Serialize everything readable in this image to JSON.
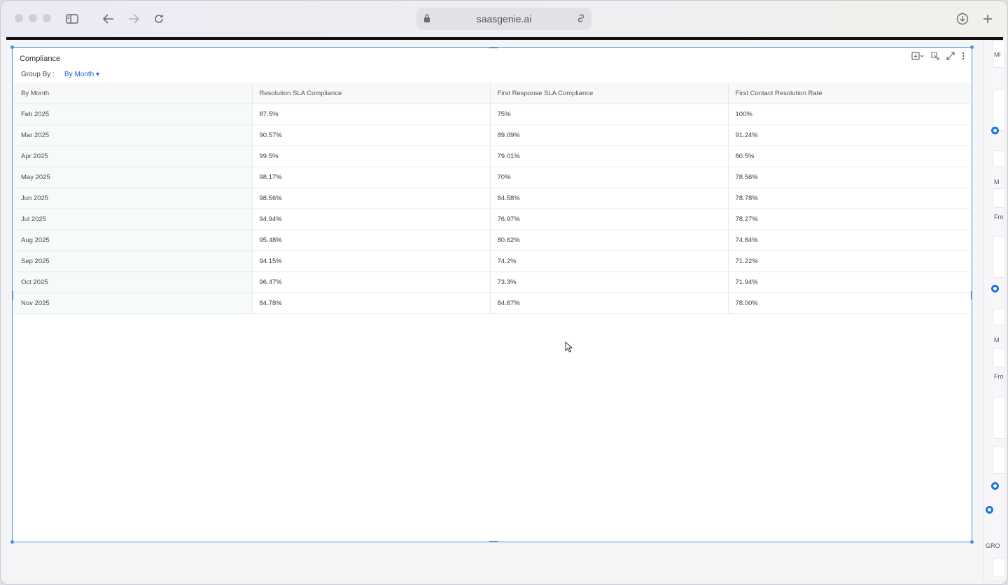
{
  "browser": {
    "url": "saasgenie.ai"
  },
  "widget": {
    "title": "Compliance",
    "group_by_label": "Group By :",
    "group_by_value": "By Month",
    "columns": [
      "By Month",
      "Resolution SLA Compliance",
      "First Response SLA Compliance",
      "First Contact Resolution Rate"
    ],
    "rows": [
      [
        "Feb 2025",
        "87.5%",
        "75%",
        "100%"
      ],
      [
        "Mar 2025",
        "90.57%",
        "89.09%",
        "91.24%"
      ],
      [
        "Apr 2025",
        "99.5%",
        "79.01%",
        "80.5%"
      ],
      [
        "May 2025",
        "98.17%",
        "70%",
        "78.56%"
      ],
      [
        "Jun 2025",
        "98.56%",
        "84.58%",
        "78.78%"
      ],
      [
        "Jul 2025",
        "94.94%",
        "76.97%",
        "78.27%"
      ],
      [
        "Aug 2025",
        "95.48%",
        "80.62%",
        "74.84%"
      ],
      [
        "Sep 2025",
        "94.15%",
        "74.2%",
        "71.22%"
      ],
      [
        "Oct 2025",
        "96.47%",
        "73.3%",
        "71.94%"
      ],
      [
        "Nov 2025",
        "84.78%",
        "84.87%",
        "78.00%"
      ]
    ]
  },
  "right_panel": {
    "labels": [
      "Mi",
      "M",
      "Fro",
      "M",
      "Fro",
      "GRO"
    ]
  }
}
